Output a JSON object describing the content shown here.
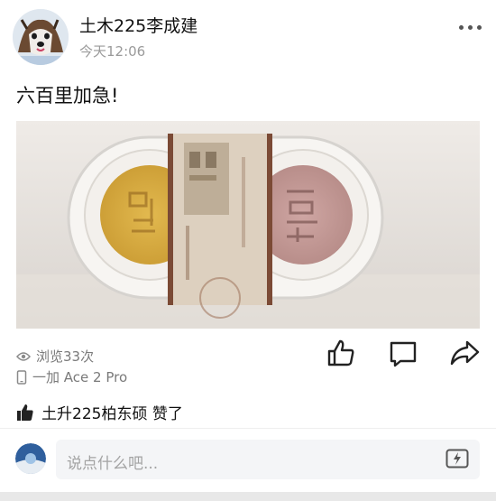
{
  "post": {
    "username": "土木225李成建",
    "time": "今天12:06",
    "text": "六百里加急!"
  },
  "stats": {
    "views": "浏览33次",
    "device": "一加 Ace 2 Pro"
  },
  "likes": {
    "text": "土升225柏东硕 赞了"
  },
  "comment": {
    "placeholder": "说点什么吧..."
  },
  "icons": {
    "more": "more-dots-icon",
    "eye": "eye-icon",
    "phone": "phone-icon",
    "like": "thumbs-up-icon",
    "comment": "comment-icon",
    "share": "share-icon",
    "emoji": "emoji-icon"
  },
  "colors": {
    "secondary_text": "#9a9a9a",
    "input_bg": "#f4f5f7"
  }
}
